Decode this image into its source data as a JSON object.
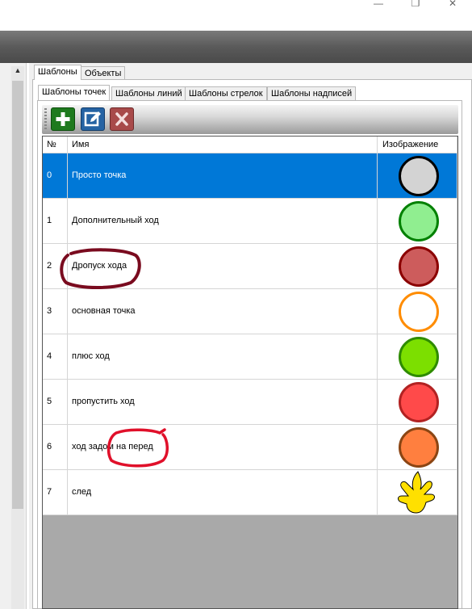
{
  "window": {
    "minimize": "—",
    "maximize": "❐",
    "close": "✕"
  },
  "outer_tabs": [
    {
      "label": "Шаблоны",
      "active": true
    },
    {
      "label": "Объекты",
      "active": false
    }
  ],
  "inner_tabs": [
    {
      "label": "Шаблоны точек",
      "active": true
    },
    {
      "label": "Шаблоны линий",
      "active": false
    },
    {
      "label": "Шаблоны стрелок",
      "active": false
    },
    {
      "label": "Шаблоны надписей",
      "active": false
    }
  ],
  "toolbar": {
    "add_icon": "plus-icon",
    "edit_icon": "edit-icon",
    "delete_icon": "delete-x-icon"
  },
  "grid": {
    "columns": {
      "num": "№",
      "name": "Имя",
      "image": "Изображение"
    },
    "rows": [
      {
        "num": "0",
        "name": "Просто точка",
        "fill": "#d3d3d3",
        "stroke": "#000000",
        "selected": true
      },
      {
        "num": "1",
        "name": "Дополнительный ход",
        "fill": "#90ee90",
        "stroke": "#008000"
      },
      {
        "num": "2",
        "name": "Дропуск хода",
        "fill": "#cd5c5c",
        "stroke": "#8b0000"
      },
      {
        "num": "3",
        "name": "основная точка",
        "fill": "#ffffff",
        "stroke": "#ff8c00"
      },
      {
        "num": "4",
        "name": "плюс ход",
        "fill": "#7cdf00",
        "stroke": "#2e8b00"
      },
      {
        "num": "5",
        "name": "пропустить ход",
        "fill": "#ff4a4a",
        "stroke": "#b22222"
      },
      {
        "num": "6",
        "name": "ход задом на перед",
        "fill": "#ff7f3f",
        "stroke": "#8b4513"
      },
      {
        "num": "7",
        "name": "след",
        "image": "footprint-icon"
      }
    ]
  },
  "annotation_colors": {
    "dark_red": "#7a0b1f",
    "red": "#e0102a"
  }
}
